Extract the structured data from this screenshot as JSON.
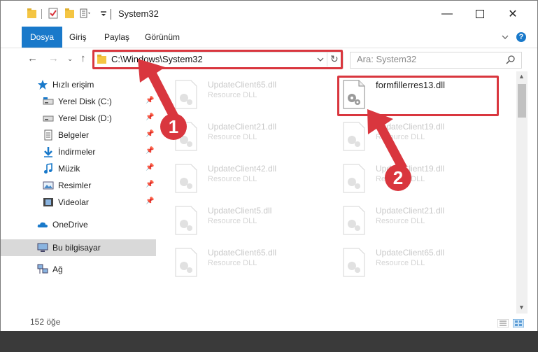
{
  "window": {
    "title": "System32"
  },
  "ribbon": {
    "tabs": [
      "Dosya",
      "Giriş",
      "Paylaş",
      "Görünüm"
    ]
  },
  "address": {
    "path": "C:\\Windows\\System32"
  },
  "search": {
    "placeholder": "Ara: System32"
  },
  "sidebar": {
    "items": [
      {
        "label": "Hızlı erişim",
        "icon": "star-icon"
      },
      {
        "label": "Yerel Disk (C:)",
        "icon": "drive-icon",
        "pinned": true
      },
      {
        "label": "Yerel Disk (D:)",
        "icon": "drive-icon",
        "pinned": true
      },
      {
        "label": "Belgeler",
        "icon": "documents-icon",
        "pinned": true
      },
      {
        "label": "İndirmeler",
        "icon": "download-icon",
        "pinned": true
      },
      {
        "label": "Müzik",
        "icon": "music-icon",
        "pinned": true
      },
      {
        "label": "Resimler",
        "icon": "pictures-icon",
        "pinned": true
      },
      {
        "label": "Videolar",
        "icon": "videos-icon",
        "pinned": true
      },
      {
        "label": "OneDrive",
        "icon": "cloud-icon"
      },
      {
        "label": "Bu bilgisayar",
        "icon": "computer-icon",
        "selected": true
      },
      {
        "label": "Ağ",
        "icon": "network-icon"
      }
    ]
  },
  "files": [
    {
      "name": "UpdateClient65.dll",
      "type": "Resource DLL"
    },
    {
      "name": "formfillerres13.dll",
      "type": "",
      "highlighted": true
    },
    {
      "name": "UpdateClient21.dll",
      "type": "Resource DLL"
    },
    {
      "name": "UpdateClient19.dll",
      "type": "Resource DLL"
    },
    {
      "name": "UpdateClient42.dll",
      "type": "Resource DLL"
    },
    {
      "name": "UpdateClient19.dll",
      "type": "Resource DLL"
    },
    {
      "name": "UpdateClient5.dll",
      "type": "Resource DLL"
    },
    {
      "name": "UpdateClient21.dll",
      "type": "Resource DLL"
    },
    {
      "name": "UpdateClient65.dll",
      "type": "Resource DLL"
    },
    {
      "name": "UpdateClient65.dll",
      "type": "Resource DLL"
    }
  ],
  "status": {
    "count": "152 öğe"
  },
  "annotations": {
    "step1": "1",
    "step2": "2"
  },
  "colors": {
    "accent": "#1979ca",
    "highlight": "#d9363e"
  }
}
